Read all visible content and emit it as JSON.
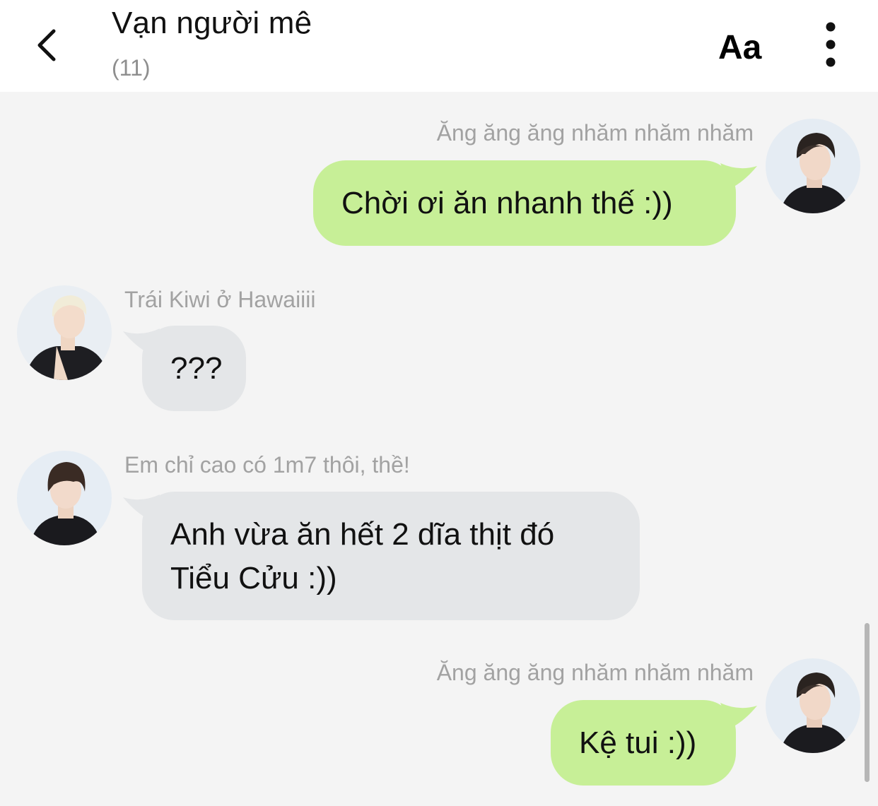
{
  "header": {
    "title": "Vạn người mê",
    "member_count": "(11)",
    "font_button": "Aa"
  },
  "messages": [
    {
      "sender": "Ăng ăng ăng nhăm nhăm nhăm",
      "text": "Chời ơi ăn nhanh thế :))",
      "side": "right"
    },
    {
      "sender": "Trái Kiwi ở Hawaiiii",
      "text": "???",
      "side": "left"
    },
    {
      "sender": "Em chỉ cao có 1m7 thôi, thề!",
      "text_lines": [
        "Anh vừa ăn hết 2 dĩa thịt đó",
        "Tiểu Cửu :))"
      ],
      "side": "left"
    },
    {
      "sender": "Ăng ăng ăng nhăm nhăm nhăm",
      "text": "Kệ tui :))",
      "side": "right"
    }
  ],
  "colors": {
    "my_bubble": "#c7ef97",
    "their_bubble": "#e4e6e8",
    "background": "#f4f4f4",
    "header": "#ffffff"
  }
}
